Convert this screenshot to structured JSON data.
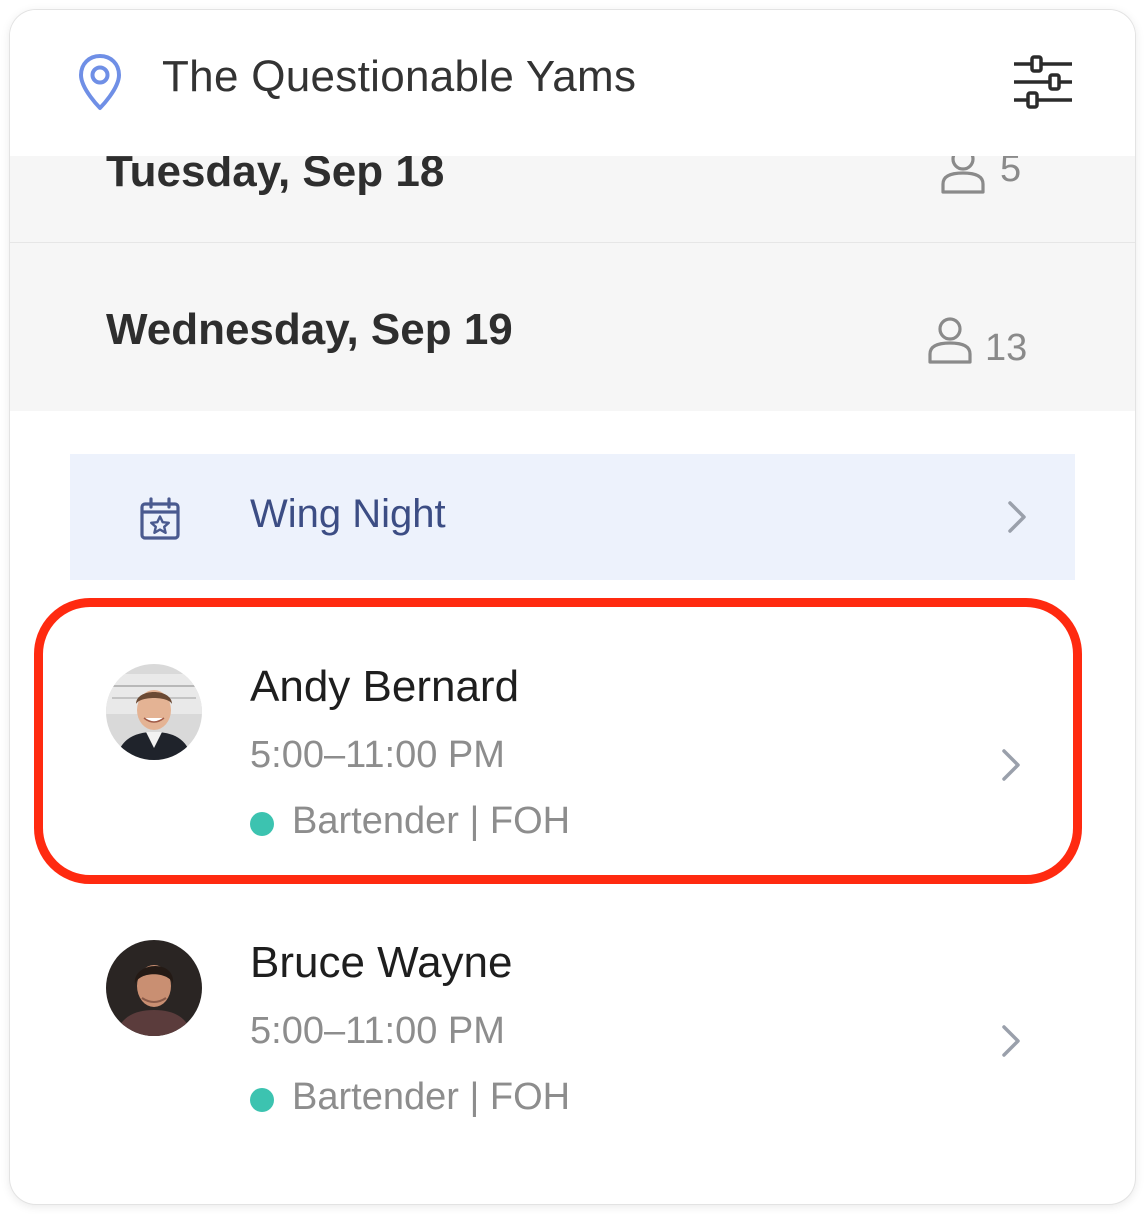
{
  "header": {
    "location_name": "The Questionable Yams"
  },
  "days": [
    {
      "label": "Tuesday, Sep  18",
      "count": "5"
    },
    {
      "label": "Wednesday, Sep  19",
      "count": "13"
    }
  ],
  "event": {
    "label": "Wing Night"
  },
  "shifts": [
    {
      "name": "Andy Bernard",
      "time": "5:00–11:00 PM",
      "role": "Bartender | FOH"
    },
    {
      "name": "Bruce Wayne",
      "time": "5:00–11:00 PM",
      "role": "Bartender | FOH"
    }
  ],
  "colors": {
    "accent_icon": "#6f8fe6",
    "event_background": "#edf2fc",
    "role_dot": "#3cc3b0",
    "highlight": "#ff2a10"
  },
  "icons": [
    "location-pin-icon",
    "filter-sliders-icon",
    "person-icon",
    "calendar-star-icon",
    "chevron-right-icon"
  ]
}
